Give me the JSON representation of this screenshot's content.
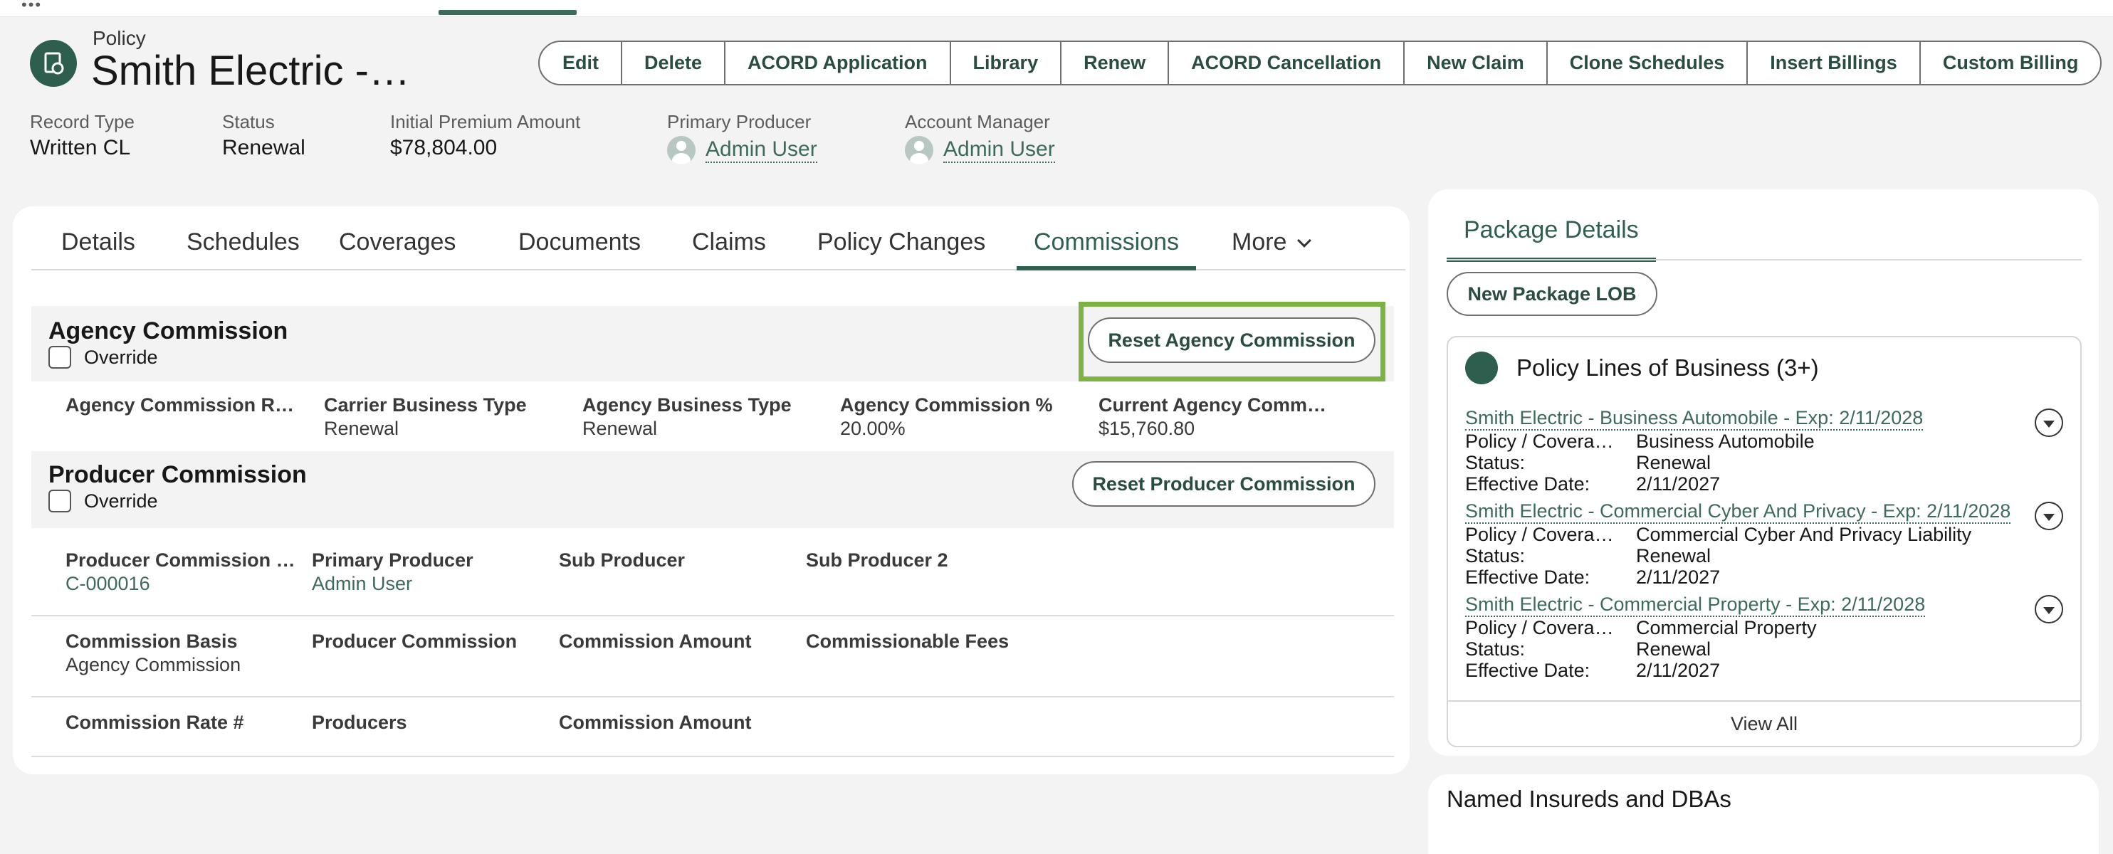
{
  "header": {
    "object_label": "Policy",
    "title": "Smith Electric -…",
    "actions": [
      "Edit",
      "Delete",
      "ACORD Application",
      "Library",
      "Renew",
      "ACORD Cancellation",
      "New Claim",
      "Clone Schedules",
      "Insert Billings",
      "Custom Billing"
    ],
    "meta": {
      "record_type": {
        "label": "Record Type",
        "value": "Written CL"
      },
      "status": {
        "label": "Status",
        "value": "Renewal"
      },
      "premium": {
        "label": "Initial Premium Amount",
        "value": "$78,804.00"
      },
      "producer": {
        "label": "Primary Producer",
        "value": "Admin User"
      },
      "manager": {
        "label": "Account Manager",
        "value": "Admin User"
      }
    }
  },
  "tabs": {
    "items": [
      "Details",
      "Schedules",
      "Coverages",
      "Documents",
      "Claims",
      "Policy Changes",
      "Commissions",
      "More"
    ],
    "active": "Commissions"
  },
  "agency": {
    "title": "Agency Commission",
    "override_label": "Override",
    "override_checked": false,
    "reset_label": "Reset Agency Commission",
    "highlight_color": "#7cb342",
    "fields": [
      {
        "label": "Agency Commission R…",
        "value": ""
      },
      {
        "label": "Carrier Business Type",
        "value": "Renewal"
      },
      {
        "label": "Agency Business Type",
        "value": "Renewal"
      },
      {
        "label": "Agency Commission %",
        "value": "20.00%"
      },
      {
        "label": "Current Agency Comm…",
        "value": "$15,760.80"
      }
    ]
  },
  "producer": {
    "title": "Producer Commission",
    "override_label": "Override",
    "override_checked": false,
    "reset_label": "Reset Producer Commission",
    "row1": [
      {
        "label": "Producer Commission …",
        "value": "C-000016"
      },
      {
        "label": "Primary Producer",
        "value": "Admin User"
      },
      {
        "label": "Sub Producer",
        "value": ""
      },
      {
        "label": "Sub Producer 2",
        "value": ""
      }
    ],
    "row2": [
      {
        "label": "Commission Basis",
        "value": "Agency Commission"
      },
      {
        "label": "Producer Commission",
        "value": ""
      },
      {
        "label": "Commission Amount",
        "value": ""
      },
      {
        "label": "Commissionable Fees",
        "value": ""
      }
    ],
    "row3": [
      {
        "label": "Commission Rate #",
        "value": ""
      },
      {
        "label": "Producers",
        "value": ""
      },
      {
        "label": "Commission Amount",
        "value": ""
      }
    ]
  },
  "package": {
    "tab_label": "Package Details",
    "new_lob_label": "New Package LOB",
    "lob_title": "Policy Lines of Business (3+)",
    "key_policy": "Policy / Covera…",
    "key_status": "Status:",
    "key_effective": "Effective Date:",
    "items": [
      {
        "title": "Smith Electric - Business Automobile - Exp: 2/11/2028",
        "coverage": "Business Automobile",
        "status": "Renewal",
        "effective": "2/11/2027"
      },
      {
        "title": "Smith Electric - Commercial Cyber And Privacy - Exp: 2/11/2028",
        "coverage": "Commercial Cyber And Privacy Liability",
        "status": "Renewal",
        "effective": "2/11/2027"
      },
      {
        "title": "Smith Electric - Commercial Property - Exp: 2/11/2028",
        "coverage": "Commercial Property",
        "status": "Renewal",
        "effective": "2/11/2027"
      }
    ],
    "view_all": "View All"
  },
  "named_insureds": {
    "title": "Named Insureds and DBAs"
  },
  "colors": {
    "accent": "#2f5f50",
    "link": "#3d6b5b"
  }
}
